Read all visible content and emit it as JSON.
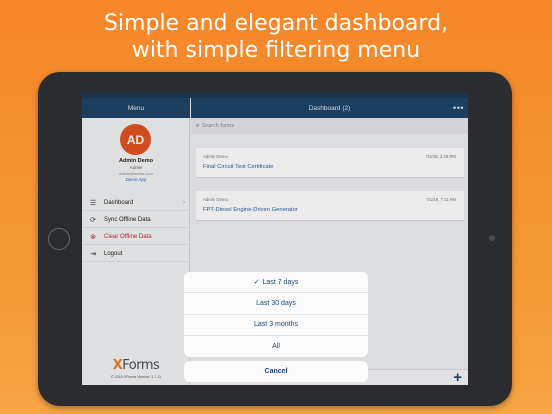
{
  "promo": {
    "line1": "Simple and elegant dashboard,",
    "line2": "with simple filtering menu"
  },
  "header": {
    "side_title": "Menu",
    "main_title": "Dashboard (2)",
    "more_icon": "more-dots-icon"
  },
  "user": {
    "initials": "AD",
    "name": "Admin Demo",
    "role": "Admin",
    "email": "admin@demo.com",
    "app": "Demo App"
  },
  "menu": {
    "items": [
      {
        "label": "Dashboard",
        "icon": "list-icon"
      },
      {
        "label": "Sync Offline Data",
        "icon": "sync-icon"
      },
      {
        "label": "Clear Offline Data",
        "icon": "clear-icon"
      },
      {
        "label": "Logout",
        "icon": "logout-icon"
      }
    ]
  },
  "brand": {
    "logo_x": "X",
    "logo_rest": "Forms",
    "copyright": "© 2018 XForms Version: 3.7.11"
  },
  "search": {
    "placeholder": "Search forms"
  },
  "forms": [
    {
      "user": "Admin Demo",
      "date": "7/3/18, 2:19 PM",
      "title": "Final Circuit Test Certificate"
    },
    {
      "user": "Admin Demo",
      "date": "7/1/18, 7:11 AM",
      "title": "FPT-Diesel Engine-Driven Generator"
    }
  ],
  "filter_sheet": {
    "options": [
      {
        "label": "Last 7 days",
        "selected": "✓"
      },
      {
        "label": "Last 30 days",
        "selected": ""
      },
      {
        "label": "Last 3 months",
        "selected": ""
      },
      {
        "label": "All",
        "selected": ""
      }
    ],
    "cancel_label": "Cancel"
  },
  "colors": {
    "accent": "#1f4468",
    "avatar": "#e2531f",
    "danger": "#c62b2b",
    "background": "#f6862a"
  }
}
